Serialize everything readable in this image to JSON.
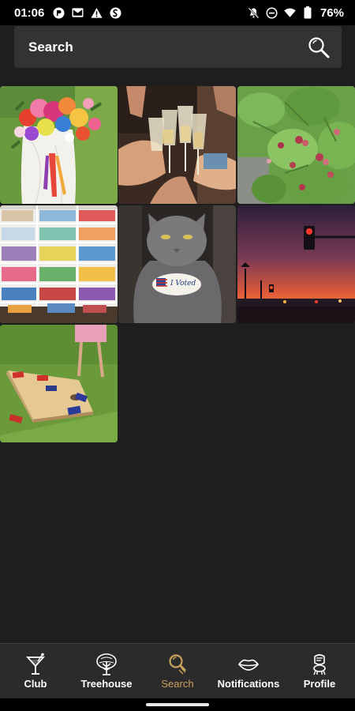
{
  "status_bar": {
    "time": "01:06",
    "battery_percent": "76%",
    "left_icons": [
      "p-app-icon",
      "gmail-icon",
      "warning-icon",
      "shazam-icon"
    ],
    "right_icons": [
      "mute-icon",
      "dnd-icon",
      "wifi-icon",
      "battery-icon"
    ]
  },
  "search": {
    "placeholder": "Search"
  },
  "results": [
    {
      "subject": "bouquet",
      "icon": "photo-bouquet"
    },
    {
      "subject": "toast",
      "icon": "photo-champagne-toast"
    },
    {
      "subject": "berries",
      "icon": "photo-raspberry-bush"
    },
    {
      "subject": "bookshelf",
      "icon": "photo-bookshelf"
    },
    {
      "subject": "cat",
      "icon": "photo-cat-voted-sticker"
    },
    {
      "subject": "sunset",
      "icon": "photo-sunset-traffic-light"
    },
    {
      "subject": "cornhole",
      "icon": "photo-cornhole"
    }
  ],
  "cat_sticker_text": "I Voted",
  "bottom_nav": {
    "items": [
      {
        "label": "Club",
        "icon": "cocktail-icon"
      },
      {
        "label": "Treehouse",
        "icon": "tree-icon"
      },
      {
        "label": "Search",
        "icon": "search-icon",
        "active": true
      },
      {
        "label": "Notifications",
        "icon": "lips-icon"
      },
      {
        "label": "Profile",
        "icon": "profile-icon"
      }
    ]
  },
  "colors": {
    "background": "#1e1e1e",
    "search_bar": "#333333",
    "nav_bar": "#2b2b2b",
    "active_accent": "#c8a15a"
  }
}
